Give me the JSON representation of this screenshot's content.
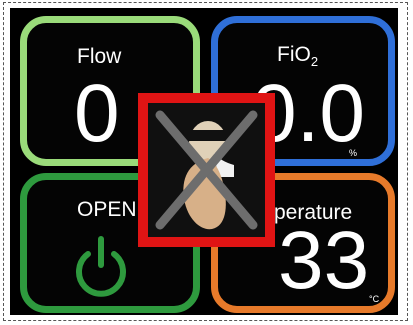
{
  "colors": {
    "flow": "#9adb7a",
    "fio2": "#2f6fd8",
    "open": "#2e9a3e",
    "temp": "#e77a2a",
    "overlay_border": "#e01414"
  },
  "flow": {
    "label": "Flow",
    "value": "0"
  },
  "fio2": {
    "label_main": "FiO",
    "label_sub": "2",
    "value": "0.0",
    "unit": "%"
  },
  "open": {
    "label": "OPEN",
    "icon": "power-icon"
  },
  "temperature": {
    "label": "perature",
    "value": "33",
    "unit": "°C"
  },
  "overlay": {
    "icon": "no-entry-person-icon"
  }
}
